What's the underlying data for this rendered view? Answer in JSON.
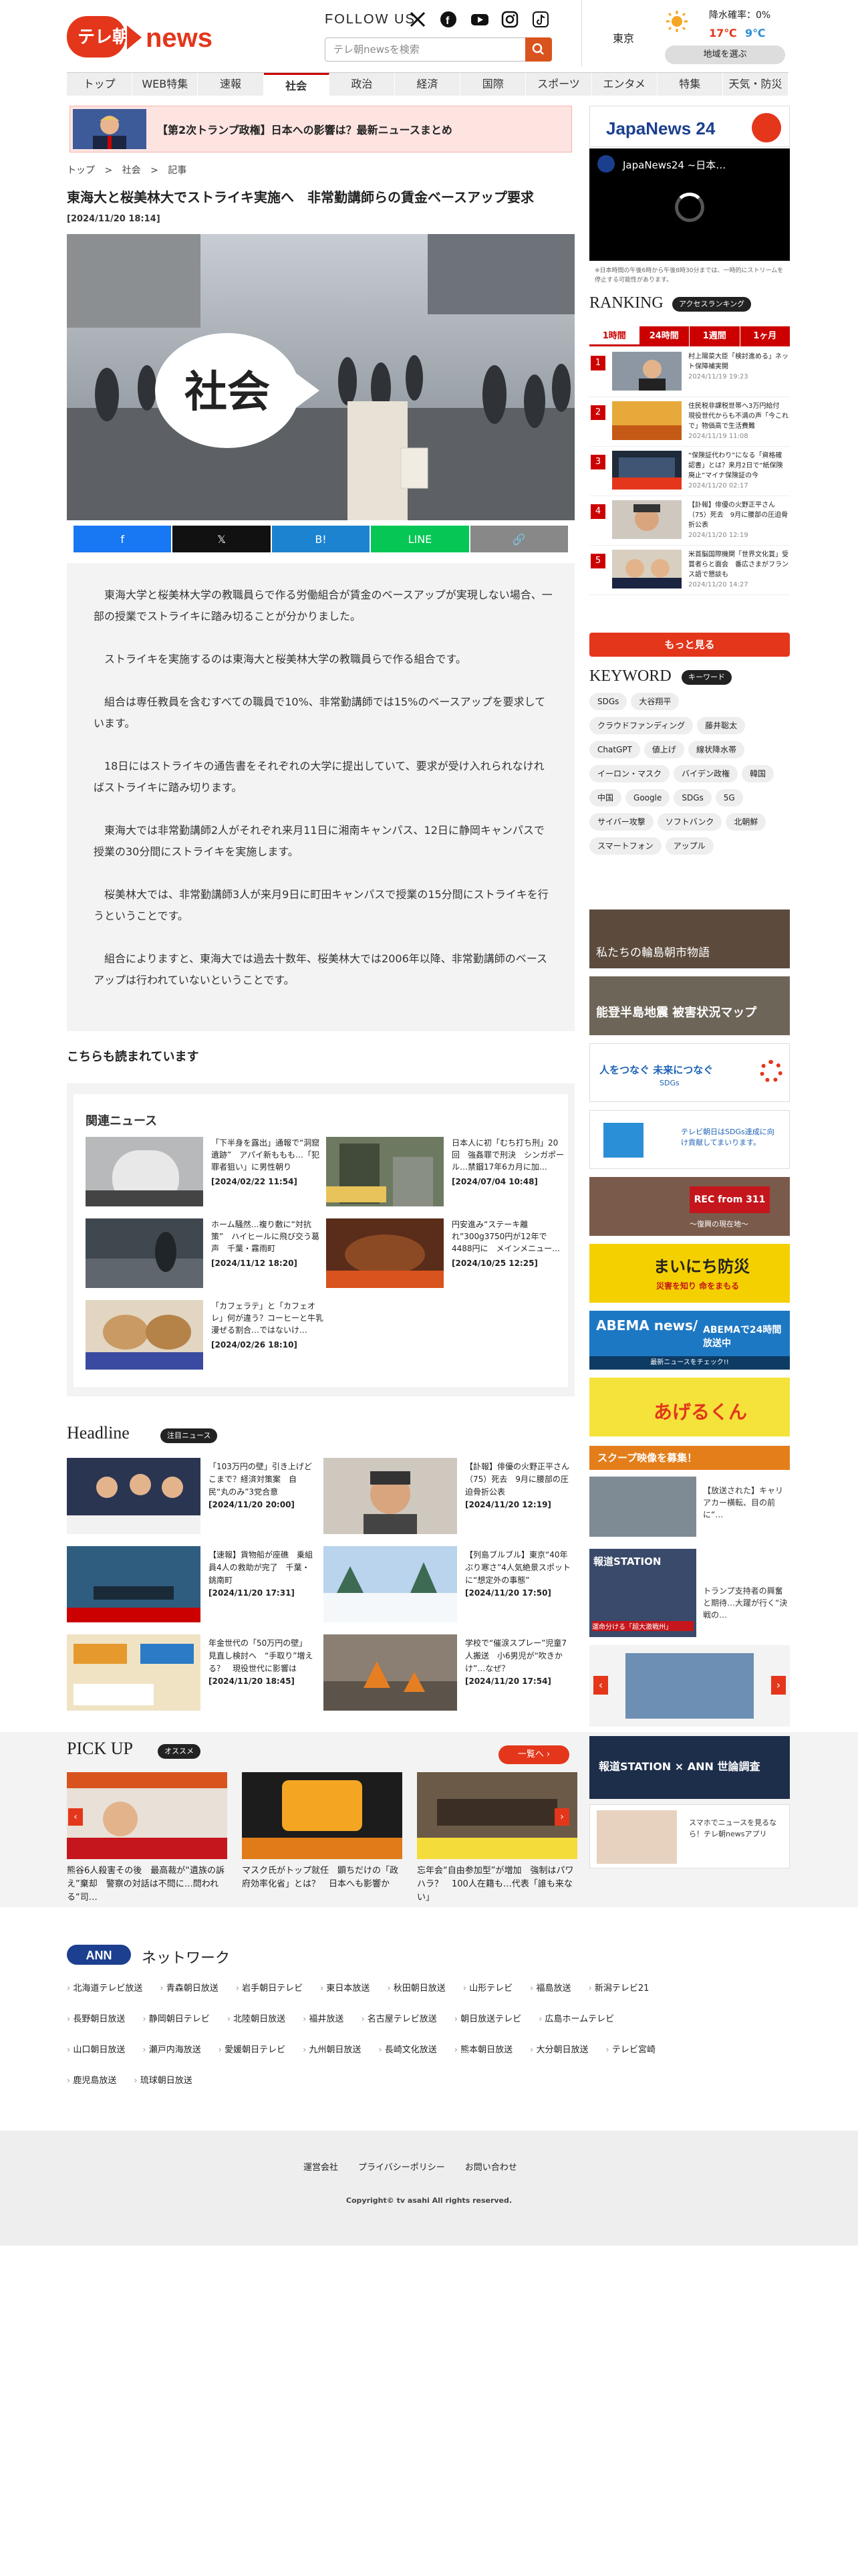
{
  "header": {
    "logo_ja": "テレ朝",
    "logo_en": "news",
    "follow_label": "FOLLOW US",
    "search_placeholder": "テレ朝newsを検索",
    "weather": {
      "city": "東京",
      "rain_label": "降水確率：0%",
      "high": "17℃",
      "low": "9℃",
      "region_button": "地域を選ぶ"
    }
  },
  "nav": [
    "トップ",
    "WEB特集",
    "速報",
    "社会",
    "政治",
    "経済",
    "国際",
    "スポーツ",
    "エンタメ",
    "特集",
    "天気・防災"
  ],
  "banner": {
    "text": "【第2次トランプ政権】日本への影響は？最新ニュースまとめ"
  },
  "breadcrumb": [
    "トップ",
    "社会",
    "記事"
  ],
  "article": {
    "title": "東海大と桜美林大でストライキ実施へ　非常勤講師らの賃金ベースアップ要求",
    "date": "[2024/11/20 18:14]",
    "photo_caption": "社会",
    "share": [
      "f",
      "𝕏",
      "B!",
      "LINE",
      "🔗"
    ],
    "paragraphs": [
      "東海大学と桜美林大学の教職員らで作る労働組合が賃金のベースアップが実現しない場合、一部の授業でストライキに踏み切ることが分かりました。",
      "ストライキを実施するのは東海大と桜美林大学の教職員らで作る組合です。",
      "組合は専任教員を含むすべての職員で10%、非常勤講師では15%のベースアップを要求しています。",
      "18日にはストライキの通告書をそれぞれの大学に提出していて、要求が受け入れられなければストライキに踏み切ります。",
      "東海大では非常勤講師2人がそれぞれ来月11日に湘南キャンパス、12日に静岡キャンパスで授業の30分間にストライキを実施します。",
      "桜美林大では、非常勤講師3人が来月9日に町田キャンパスで授業の15分間にストライキを行うということです。",
      "組合によりますと、東海大では過去十数年、桜美林大では2006年以降、非常勤講師のベースアップは行われていないということです。"
    ]
  },
  "also_read": "こちらも読まれています",
  "related": {
    "heading": "関連ニュース",
    "items": [
      {
        "text": "「下半身を露出」通報で“洞窟遺跡”　アパイ新ももも…「犯罪者狙い」に男性朝り",
        "date": "[2024/02/22 11:54]"
      },
      {
        "text": "日本人に初「むち打ち刑」20回　強姦罪で刑決　シンガポール…禁錮17年6カ月に加…",
        "date": "[2024/07/04 10:48]"
      },
      {
        "text": "ホーム騒然…複り敷に“対抗策”　ハイヒールに飛び交う葛声　千葉・霧雨町",
        "date": "[2024/11/12 18:20]"
      },
      {
        "text": "円安進み“ステーキ離れ”300g3750円が12年で4488円に　メインメニュー…",
        "date": "[2024/10/25 12:25]"
      },
      {
        "text": "「カフェラテ」と「カフェオレ」何が違う？コーヒーと牛乳漫ぜる割合…ではないけ…",
        "date": "[2024/02/26 18:10]"
      }
    ]
  },
  "headline": {
    "heading": "Headline",
    "badge": "注目ニュース",
    "items": [
      {
        "text": "「103万円の壁」引き上げどこまで？経済対策案　自民“丸のみ”3党合意",
        "date": "[2024/11/20 20:00]"
      },
      {
        "text": "【訃報】俳優の火野正平さん（75）死去　9月に腰部の圧迫骨折公表",
        "date": "[2024/11/20 12:19]"
      },
      {
        "text": "【速報】貨物船が座礁　乗組員4人の救助が完了　千葉・銚南町",
        "date": "[2024/11/20 17:31]"
      },
      {
        "text": "【列島ブルブル】東京“40年ぶり寒さ”4人気絶景スポットに“想定外の事態”",
        "date": "[2024/11/20 17:50]"
      },
      {
        "text": "年金世代の「50万円の壁」見直し検討へ　“手取り”増える？　現役世代に影響は",
        "date": "[2024/11/20 18:45]"
      },
      {
        "text": "学校で“催涙スプレー”児童7人搬送　小6男児が“吹きかけ”…なぜ？",
        "date": "[2024/11/20 17:54]"
      }
    ]
  },
  "pickup": {
    "heading": "PICK UP",
    "badge": "オススメ",
    "list_button": "一覧へ ›",
    "items": [
      {
        "text": "熊谷6人殺害その後　最高裁が“遺族の訴え”棄却　警察の対話は不問に…問われる“司…"
      },
      {
        "text": "マスク氏がトップ就任　顕ちだけの「政府効率化省」とは？　日本へも影響か"
      },
      {
        "text": "忘年会“自由参加型”が増加　強制はパワハラ？　100人在籍も…代表「誰も来ない」"
      }
    ]
  },
  "network": {
    "heading": "ネットワーク",
    "rows": [
      [
        "北海道テレビ放送",
        "青森朝日放送",
        "岩手朝日テレビ",
        "東日本放送",
        "秋田朝日放送",
        "山形テレビ",
        "福島放送",
        "新潟テレビ21"
      ],
      [
        "長野朝日放送",
        "静岡朝日テレビ",
        "北陸朝日放送",
        "福井放送",
        "名古屋テレビ放送",
        "朝日放送テレビ",
        "広島ホームテレビ"
      ],
      [
        "山口朝日放送",
        "瀬戸内海放送",
        "愛媛朝日テレビ",
        "九州朝日放送",
        "長崎文化放送",
        "熊本朝日放送",
        "大分朝日放送",
        "テレビ宮崎"
      ],
      [
        "鹿児島放送",
        "琉球朝日放送"
      ]
    ]
  },
  "footer": {
    "links": [
      "運営会社",
      "プライバシーポリシー",
      "お問い合わせ"
    ],
    "copyright": "Copyright© tv asahi All rights reserved."
  },
  "sidebar": {
    "jn24_title": "JapaNews 24",
    "jn24_video_title": "JapaNews24 ~日本…",
    "jn24_note": "※日本時間の午後6時から午後8時30分までは、一時的にストリームを停止する可能性があります。",
    "ranking_heading": "RANKING",
    "ranking_badge": "アクセスランキング",
    "ranking_tabs": [
      "1時間",
      "24時間",
      "1週間",
      "1ヶ月"
    ],
    "ranking": [
      {
        "num": "1",
        "text": "村上陽菜大臣「検討進める」ネット保障補実開",
        "date": "2024/11/19 19:23"
      },
      {
        "num": "2",
        "text": "住民税非課税世帯へ3万円給付　現役世代からも不満の声「今これで」物価高で生活費難",
        "date": "2024/11/19 11:08"
      },
      {
        "num": "3",
        "text": "“保険証代わり”になる「資格確認書」とは？来月2日で“紙保険廃止”マイナ保険証の今",
        "date": "2024/11/20 02:17"
      },
      {
        "num": "4",
        "text": "【訃報】俳優の火野正平さん（75）死去　9月に腰部の圧迫骨折公表",
        "date": "2024/11/20 12:19"
      },
      {
        "num": "5",
        "text": "米首脳国際機関「世界文化賞」受賞者らと面会　番広さまがフランス語で懇談も",
        "date": "2024/11/20 14:27"
      }
    ],
    "more_button": "もっと見る",
    "keyword_heading": "KEYWORD",
    "keyword_badge": "キーワード",
    "keywords": [
      "SDGs",
      "大谷翔平",
      "クラウドファンディング",
      "藤井聡太",
      "ChatGPT",
      "値上げ",
      "線状降水帯",
      "イーロン・マスク",
      "バイデン政権",
      "韓国",
      "中国",
      "Google",
      "SDGs",
      "5G",
      "サイバー攻撃",
      "ソフトバンク",
      "北朝鮮",
      "スマートフォン",
      "アップル"
    ],
    "banners": {
      "noto": "私たちの輪島朝市物語",
      "noto2": "能登半島地震 被害状況マップ",
      "sdgs": "人をつなぐ 未来につなぐ",
      "sdgs_sub": "SDGs",
      "tvasahi_sdgs": "テレビ朝日はSDGs達成に向け貢献してまいります。",
      "rec311": "REC from 311",
      "rec311_sub": "～復興の現在地～",
      "bosai": "まいにち防災",
      "bosai_sub": "災害を知り 命をまもる",
      "abema": "ABEMAで24時間放送中",
      "abema_logo": "ABEMA news/",
      "abema_sub": "最新ニュースをチェック!!",
      "agerukun": "あげるくん",
      "scoop": "スクープ映像を募集！",
      "scoop_text": "【放送された】キャリアカー横転、目の前に“…",
      "hodo": "報道STATION",
      "hodo_text": "トランプ支持者の興奮と期待…大躍が行く“決戦の…",
      "hodo_sub": "運命分ける「超大激戦州」",
      "hodo_ann": "報道STATION × ANN 世論調査",
      "app_text": "スマホでニュースを見るなら！テレ朝newsアプリ"
    }
  },
  "colors": {
    "brand_red": "#e4361b",
    "accent_orange": "#d9531e",
    "rank_red": "#cc0000"
  }
}
